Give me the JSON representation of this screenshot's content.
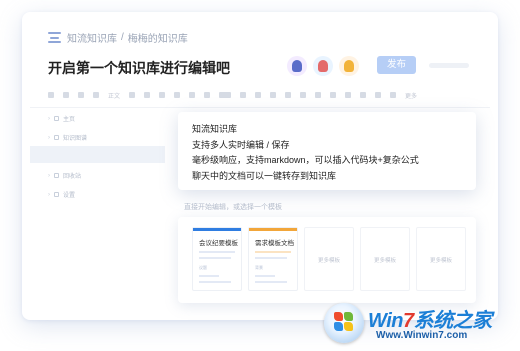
{
  "breadcrumb": {
    "space": "知流知识库",
    "separator": "/",
    "page": "梅梅的知识库"
  },
  "title": "开启第一个知识库进行编辑吧",
  "avatars": [
    "avatar-purple",
    "avatar-red",
    "avatar-orange"
  ],
  "publish_label": "发布",
  "toolbar": {
    "font_label": "正文",
    "more_label": "更多"
  },
  "sidebar": {
    "items": [
      "主页",
      "知识图谱",
      "回收站",
      "设置"
    ]
  },
  "popup": {
    "lines": [
      "知流知识库",
      "支持多人实时编辑 / 保存",
      "毫秒级响应，支持markdown，可以插入代码块+复杂公式",
      "聊天中的文档可以一键转存到知识库"
    ]
  },
  "template_hint": "直接开始编辑，或选择一个模板",
  "templates": [
    {
      "name": "会议纪要模板",
      "color": "#2f7de1",
      "tag": "议题"
    },
    {
      "name": "需求模板文档",
      "color": "#f2a63a",
      "tag": "背景"
    },
    {
      "name": "更多模板"
    },
    {
      "name": "更多模板"
    },
    {
      "name": "更多模板"
    }
  ],
  "watermark": {
    "brand_a": "Win",
    "brand_b": "7",
    "brand_c": "系统之家",
    "url": "Www.Winwin7.com"
  }
}
